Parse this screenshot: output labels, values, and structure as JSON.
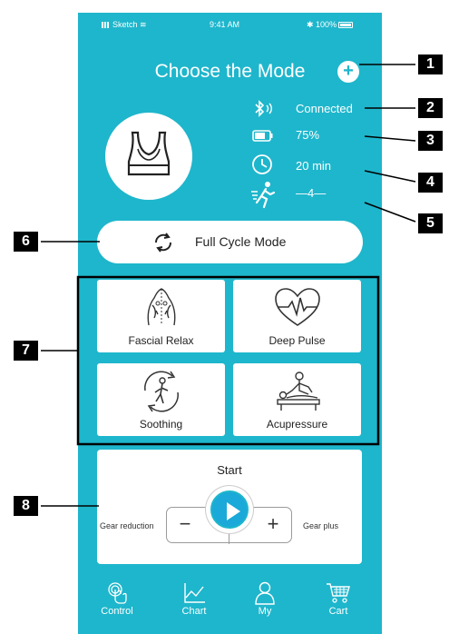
{
  "status_bar": {
    "carrier": "Sketch",
    "time": "9:41 AM",
    "battery": "100%"
  },
  "header": {
    "title": "Choose the Mode"
  },
  "device_info": {
    "connection": "Connected",
    "battery_level": "75%",
    "duration": "20 min",
    "gear": "—4—"
  },
  "full_cycle": {
    "label": "Full Cycle Mode"
  },
  "modes": [
    {
      "label": "Fascial Relax",
      "icon": "back-muscle-icon"
    },
    {
      "label": "Deep Pulse",
      "icon": "heart-pulse-icon"
    },
    {
      "label": "Soothing",
      "icon": "body-rotate-icon"
    },
    {
      "label": "Acupressure",
      "icon": "massage-icon"
    }
  ],
  "control": {
    "start_label": "Start",
    "gear_reduction": "Gear reduction",
    "gear_plus": "Gear plus",
    "minus": "−",
    "plus": "+"
  },
  "tabs": [
    {
      "label": "Control",
      "icon": "touch-icon"
    },
    {
      "label": "Chart",
      "icon": "line-chart-icon"
    },
    {
      "label": "My",
      "icon": "person-icon"
    },
    {
      "label": "Cart",
      "icon": "cart-icon"
    }
  ],
  "callouts": [
    "1",
    "2",
    "3",
    "4",
    "5",
    "6",
    "7",
    "8"
  ],
  "colors": {
    "primary": "#1eb6cc",
    "card": "#ffffff",
    "badge": "#000000"
  }
}
